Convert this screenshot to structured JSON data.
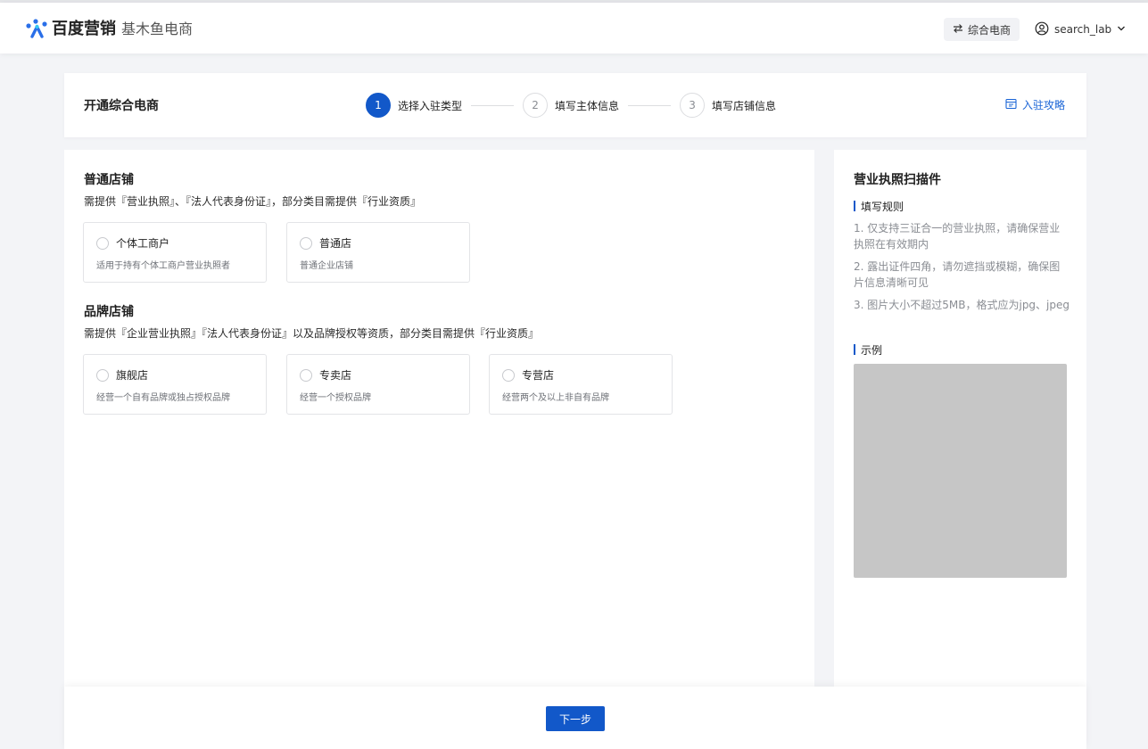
{
  "header": {
    "brand": "百度营销",
    "product": "基木鱼电商",
    "tag_label": "综合电商",
    "user_name": "search_lab",
    "icons": {
      "switch": "swap-icon",
      "user": "user-circle-icon",
      "chevron": "chevron-down-icon"
    }
  },
  "steps_card": {
    "title": "开通综合电商",
    "steps": [
      {
        "num": "1",
        "label": "选择入驻类型"
      },
      {
        "num": "2",
        "label": "填写主体信息"
      },
      {
        "num": "3",
        "label": "填写店铺信息"
      }
    ],
    "active_step": 1,
    "guide_link": "入驻攻略"
  },
  "main": {
    "sections": [
      {
        "title": "普通店铺",
        "desc": "需提供『营业执照』、『法人代表身份证』，部分类目需提供『行业资质』",
        "options": [
          {
            "name": "个体工商户",
            "desc": "适用于持有个体工商户营业执照者"
          },
          {
            "name": "普通店",
            "desc": "普通企业店铺"
          }
        ]
      },
      {
        "title": "品牌店铺",
        "desc": "需提供『企业营业执照』『法人代表身份证』以及品牌授权等资质，部分类目需提供『行业资质』",
        "options": [
          {
            "name": "旗舰店",
            "desc": "经营一个自有品牌或独占授权品牌"
          },
          {
            "name": "专卖店",
            "desc": "经营一个授权品牌"
          },
          {
            "name": "专营店",
            "desc": "经营两个及以上非自有品牌"
          }
        ]
      }
    ]
  },
  "side": {
    "title": "营业执照扫描件",
    "rules_title": "填写规则",
    "rules": [
      "1. 仅支持三证合一的营业执照，请确保营业执照在有效期内",
      "2. 露出证件四角，请勿遮挡或模糊，确保图片信息清晰可见",
      "3. 图片大小不超过5MB，格式应为jpg、jpeg"
    ],
    "example_title": "示例"
  },
  "footer": {
    "next_label": "下一步"
  },
  "colors": {
    "primary": "#1258c9",
    "link": "#1a64d6",
    "page_bg": "#f3f4f7",
    "example_placeholder": "#c6c6c6"
  }
}
